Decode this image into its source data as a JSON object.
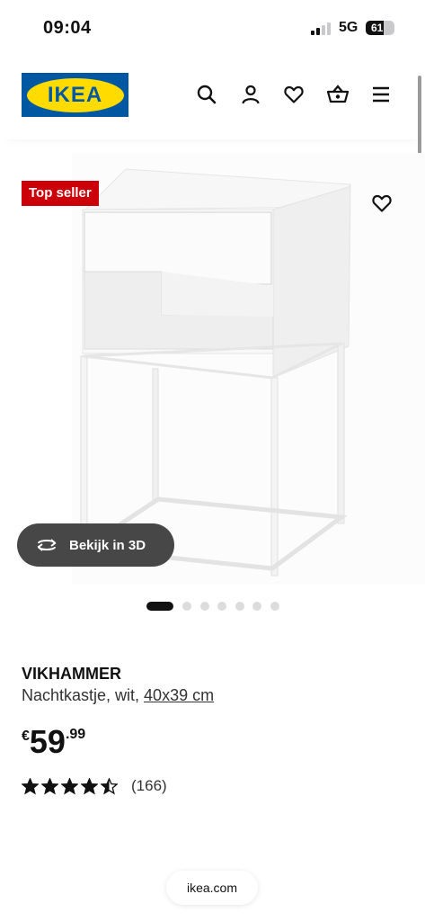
{
  "status_bar": {
    "time": "09:04",
    "network": "5G",
    "battery": "61",
    "battery_level": 0.61
  },
  "header": {
    "logo_text": "IKEA",
    "icons": [
      "search-icon",
      "user-icon",
      "heart-icon",
      "basket-icon",
      "menu-icon"
    ]
  },
  "product": {
    "badge": "Top seller",
    "view_3d_label": "Bekijk in 3D",
    "gallery": {
      "total": 7,
      "active": 1
    },
    "name": "VIKHAMMER",
    "description": "Nachtkastje, wit, ",
    "dimensions_link": "40x39 cm",
    "price": {
      "currency": "€",
      "integer": "59",
      "decimal": ".99"
    },
    "rating": {
      "stars": 4.5,
      "max": 5,
      "count": "(166)"
    }
  },
  "browser": {
    "url": "ikea.com"
  },
  "colors": {
    "ikea_blue": "#0058a3",
    "ikea_yellow": "#ffdb00",
    "badge_red": "#cc0008"
  }
}
